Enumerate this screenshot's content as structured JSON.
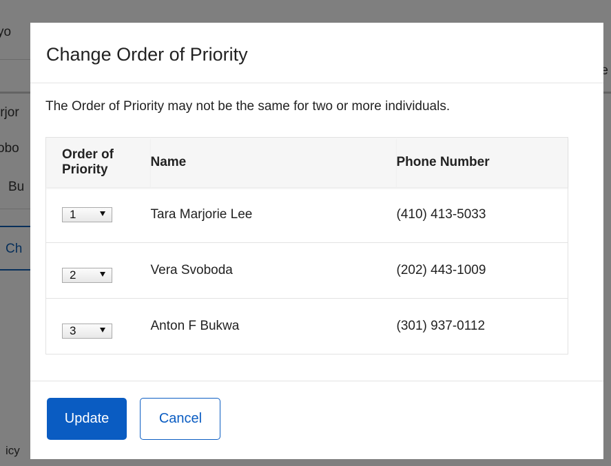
{
  "background": {
    "fragments": [
      "yo",
      "irjor",
      "obo",
      "Bu",
      "Ch",
      "icy",
      "re"
    ]
  },
  "modal": {
    "title": "Change Order of Priority",
    "note": "The Order of Priority may not be the same for two or more individuals.",
    "table": {
      "headers": {
        "order_line1": "Order of",
        "order_line2": "Priority",
        "name": "Name",
        "phone": "Phone Number"
      },
      "rows": [
        {
          "rank": "1",
          "name": "Tara Marjorie Lee",
          "phone": "(410) 413-5033"
        },
        {
          "rank": "2",
          "name": "Vera Svoboda",
          "phone": "(202) 443-1009"
        },
        {
          "rank": "3",
          "name": "Anton F Bukwa",
          "phone": "(301) 937-0112"
        }
      ]
    },
    "footer": {
      "update_label": "Update",
      "cancel_label": "Cancel"
    }
  },
  "colors": {
    "primary": "#0a5cc2",
    "overlay": "#000000"
  },
  "icons": [
    "chevron-down-icon"
  ]
}
